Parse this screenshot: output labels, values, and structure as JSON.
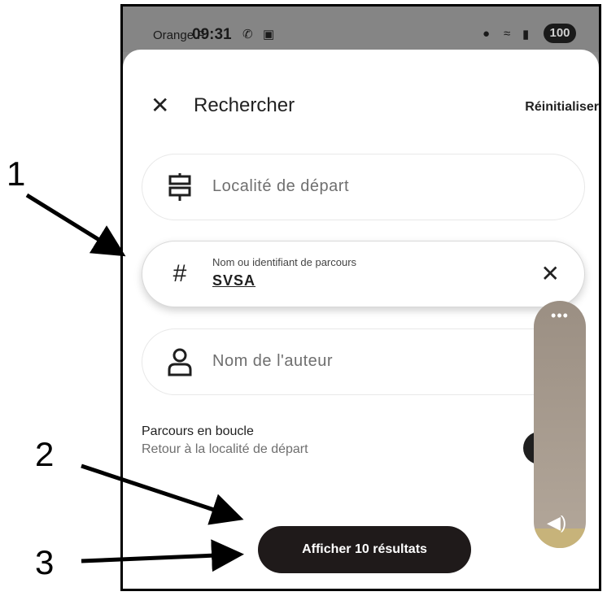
{
  "status_bar": {
    "carrier": "Orange F",
    "time": "09:31",
    "battery": "100"
  },
  "header": {
    "close_icon": "close-icon",
    "title": "Rechercher",
    "reset_label": "Réinitialiser"
  },
  "fields": {
    "departure": {
      "placeholder": "Localité de départ",
      "icon": "signpost-icon"
    },
    "route": {
      "label": "Nom ou identifiant de parcours",
      "value": "SVSA",
      "icon": "hash-icon",
      "clear_icon": "close-icon"
    },
    "author": {
      "placeholder": "Nom de l'auteur",
      "icon": "person-icon"
    }
  },
  "loop": {
    "title": "Parcours en boucle",
    "subtitle": "Retour à la localité de départ",
    "enabled": true
  },
  "cta": {
    "label": "Afficher 10 résultats"
  },
  "volume_overlay": {
    "menu_icon": "more-icon",
    "speaker_icon": "speaker-icon",
    "level": 0.08
  },
  "annotations": [
    "1",
    "2",
    "3"
  ],
  "colors": {
    "accent": "#1f1a1a",
    "volume_panel": "#a89c90",
    "volume_fill": "#c7b37a"
  }
}
